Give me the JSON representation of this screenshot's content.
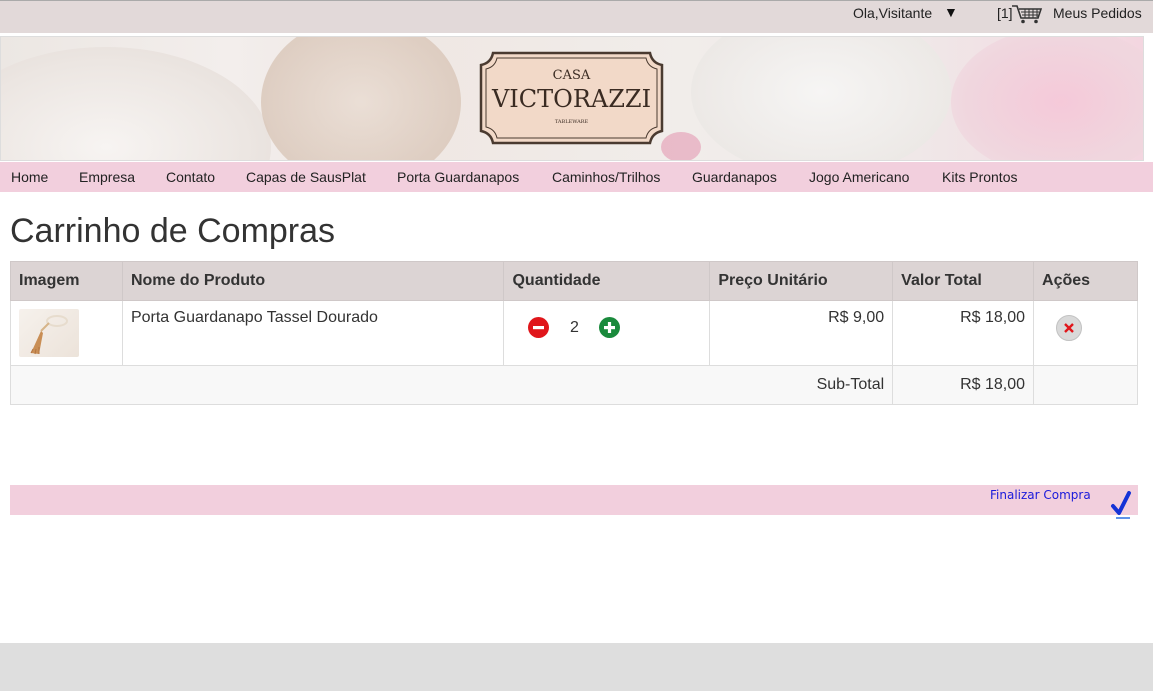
{
  "topbar": {
    "greeting": "Ola,Visitante",
    "caret": "▼",
    "cart_count": "[1]",
    "cart_icon": "shopping-cart-icon",
    "orders_label": "Meus Pedidos"
  },
  "logo": {
    "line1": "CASA",
    "line2": "VICTORAZZI",
    "line3": "TABLEWARE"
  },
  "nav": {
    "items": [
      "Home",
      "Empresa",
      "Contato",
      "Capas de SausPlat",
      "Porta Guardanapos",
      "Caminhos/Trilhos",
      "Guardanapos",
      "Jogo Americano",
      "Kits Prontos"
    ]
  },
  "page": {
    "title": "Carrinho de Compras"
  },
  "table": {
    "headers": [
      "Imagem",
      "Nome do Produto",
      "Quantidade",
      "Preço Unitário",
      "Valor Total",
      "Ações"
    ],
    "rows": [
      {
        "product": "Porta Guardanapo Tassel Dourado",
        "quantity": "2",
        "unit_price": "R$ 9,00",
        "total": "R$ 18,00"
      }
    ],
    "subtotal_label": "Sub-Total",
    "subtotal_value": "R$ 18,00"
  },
  "checkout": {
    "label": "Finalizar Compra",
    "icon": "checkmark-icon"
  },
  "colors": {
    "nav_bg": "#f2cfdd",
    "topbar_bg": "#e2d9d9",
    "header_bg": "#dcd4d4",
    "minus": "#e0161b",
    "plus": "#1a8a3c",
    "link": "#1a1adb"
  }
}
